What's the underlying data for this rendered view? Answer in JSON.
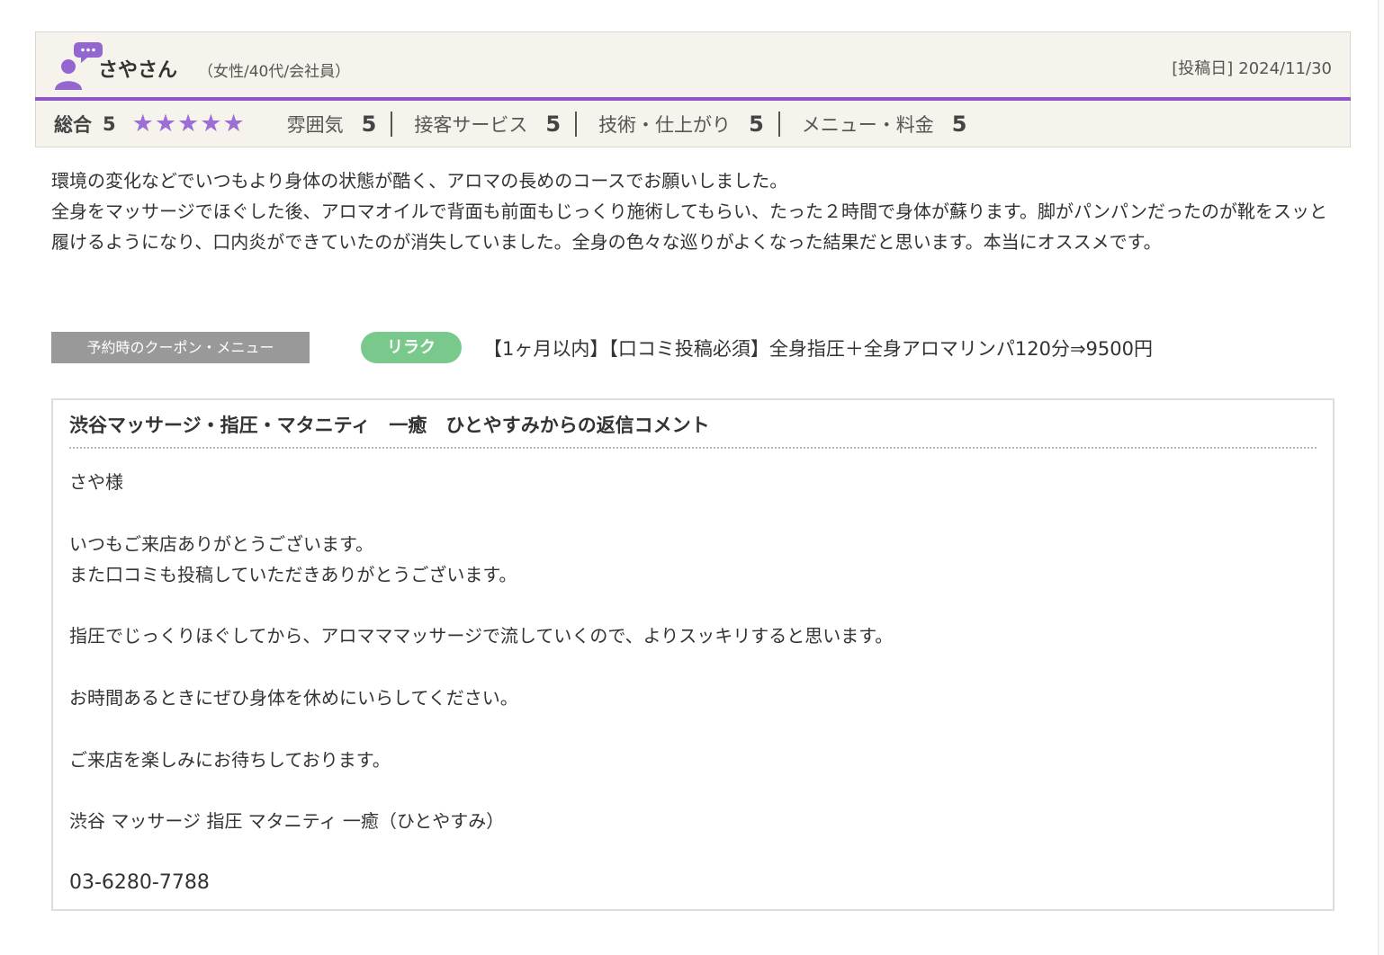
{
  "colors": {
    "accent_purple": "#8f56c9",
    "header_bg": "#f5f3ec",
    "coupon_label_bg": "#999999",
    "category_badge_bg": "#79c98c",
    "star_color": "#9c6fd6"
  },
  "icons": {
    "user": "user-speech-bubble-icon",
    "star": "star-icon"
  },
  "review": {
    "reviewer_name": "さやさん",
    "reviewer_profile": "（女性/40代/会社員）",
    "post_date_label": "[投稿日]",
    "post_date": "2024/11/30",
    "overall_label": "総合",
    "overall_score": "5",
    "stars": "★★★★★",
    "star_count": 5,
    "ratings": [
      {
        "label": "雰囲気",
        "value": "5"
      },
      {
        "label": "接客サービス",
        "value": "5"
      },
      {
        "label": "技術・仕上がり",
        "value": "5"
      },
      {
        "label": "メニュー・料金",
        "value": "5"
      }
    ],
    "body": [
      "環境の変化などでいつもより身体の状態が酷く、アロマの長めのコースでお願いしました。",
      "全身をマッサージでほぐした後、アロマオイルで背面も前面もじっくり施術してもらい、たった２時間で身体が蘇ります。脚がパンパンだったのが靴をスッと履けるようになり、口内炎ができていたのが消失していました。全身の色々な巡りがよくなった結果だと思います。本当にオススメです。"
    ]
  },
  "coupon": {
    "label": "予約時のクーポン・メニュー",
    "category": "リラク",
    "text": "【1ヶ月以内】【口コミ投稿必須】全身指圧＋全身アロマリンパ120分⇒9500円"
  },
  "reply": {
    "title": "渋谷マッサージ・指圧・マタニティ　一癒　ひとやすみからの返信コメント",
    "greeting": "さや様",
    "line1": "いつもご来店ありがとうございます。",
    "line2": "また口コミも投稿していただきありがとうございます。",
    "line3": "指圧でじっくりほぐしてから、アロマママッサージで流していくので、よりスッキリすると思います。",
    "line4": "お時間あるときにぜひ身体を休めにいらしてください。",
    "line5": "ご来店を楽しみにお待ちしております。",
    "signature": "渋谷 マッサージ 指圧 マタニティ 一癒（ひとやすみ）",
    "phone": "03-6280-7788"
  }
}
